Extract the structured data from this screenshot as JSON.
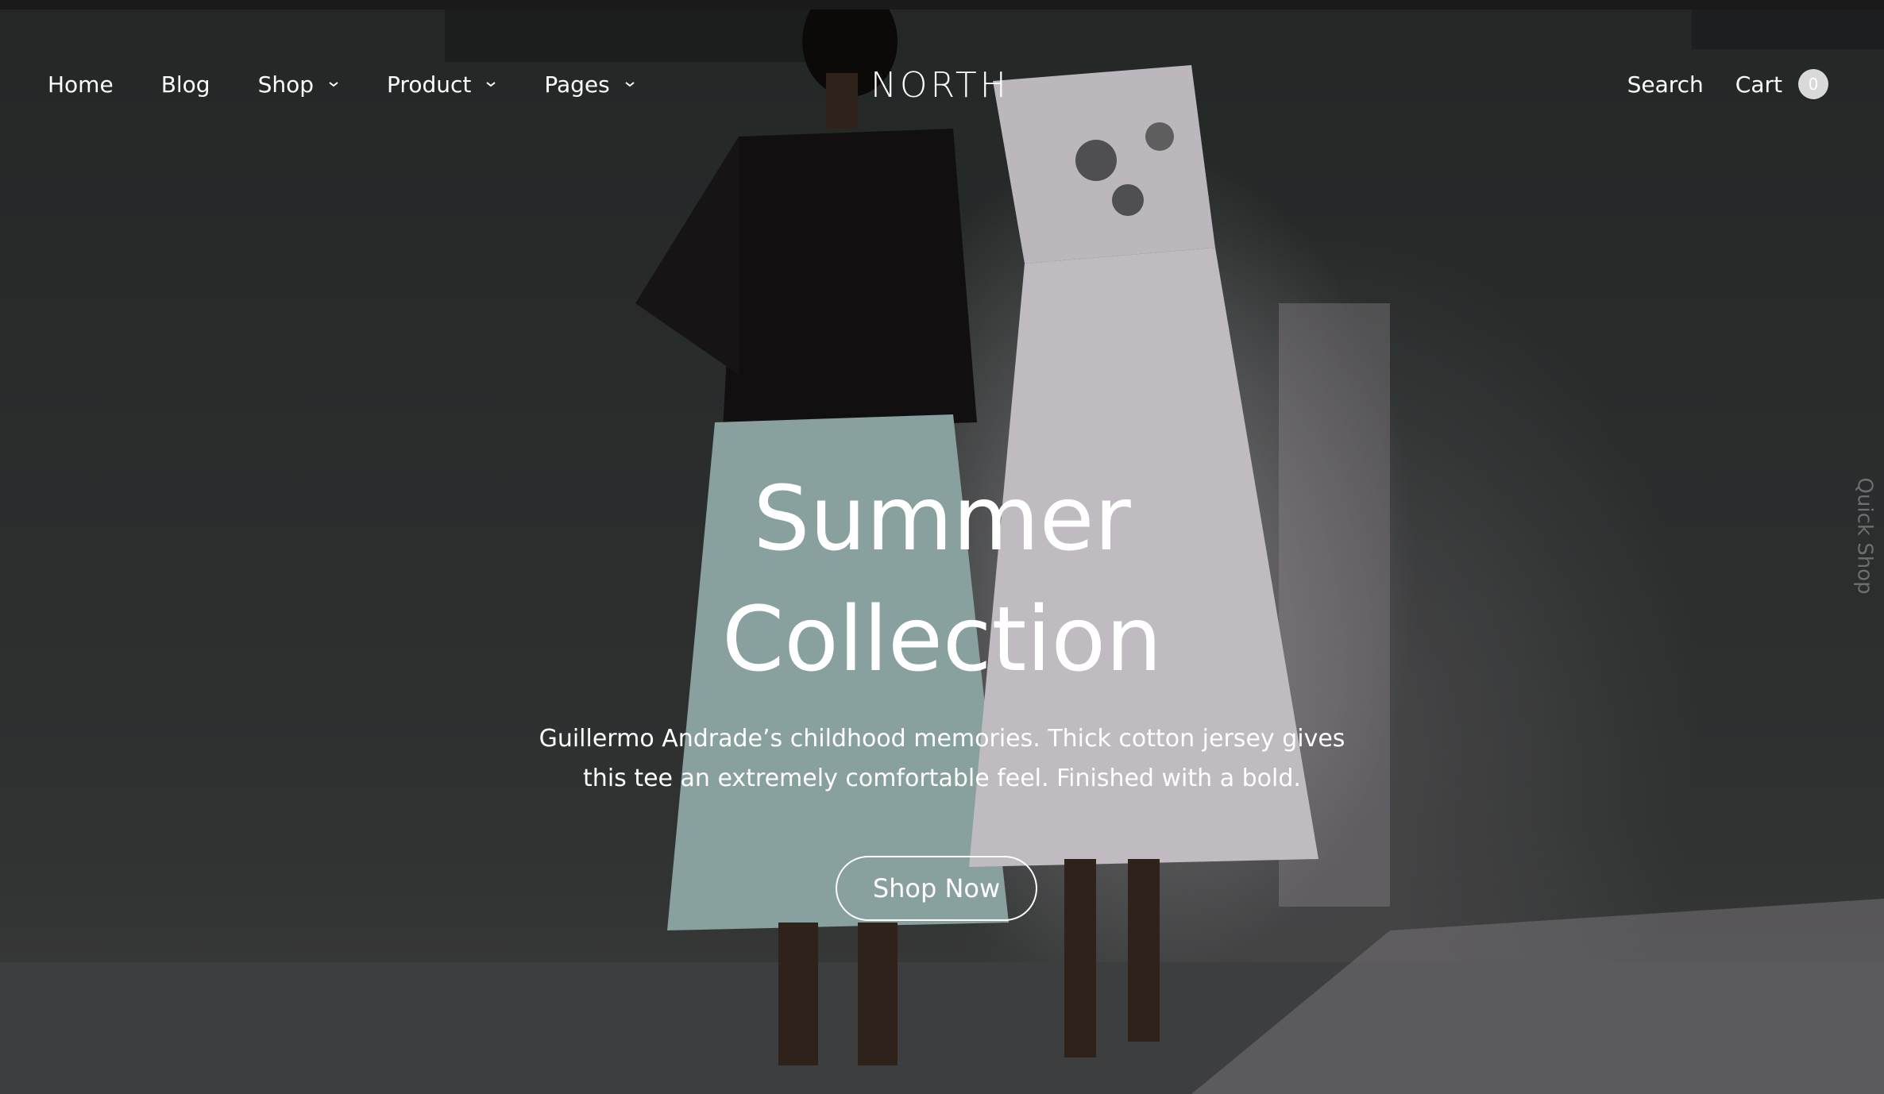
{
  "nav": {
    "items": [
      {
        "label": "Home",
        "has_dropdown": false
      },
      {
        "label": "Blog",
        "has_dropdown": false
      },
      {
        "label": "Shop",
        "has_dropdown": true
      },
      {
        "label": "Product",
        "has_dropdown": true
      },
      {
        "label": "Pages",
        "has_dropdown": true
      }
    ]
  },
  "brand": {
    "logo_text": "NORTH"
  },
  "header_right": {
    "search_label": "Search",
    "cart_label": "Cart",
    "cart_count": "0"
  },
  "hero": {
    "title_line1": "Summer",
    "title_line2": "Collection",
    "description_line1": "Guillermo Andrade’s childhood memories. Thick cotton jersey gives",
    "description_line2": "this tee an extremely comfortable feel. Finished with a bold.",
    "cta_label": "Shop Now"
  },
  "side_tab": {
    "label": "Quick Shop"
  },
  "colors": {
    "text": "#ffffff",
    "badge_bg": "#d9d9d9",
    "side_tab_text": "#6d6f6f"
  }
}
